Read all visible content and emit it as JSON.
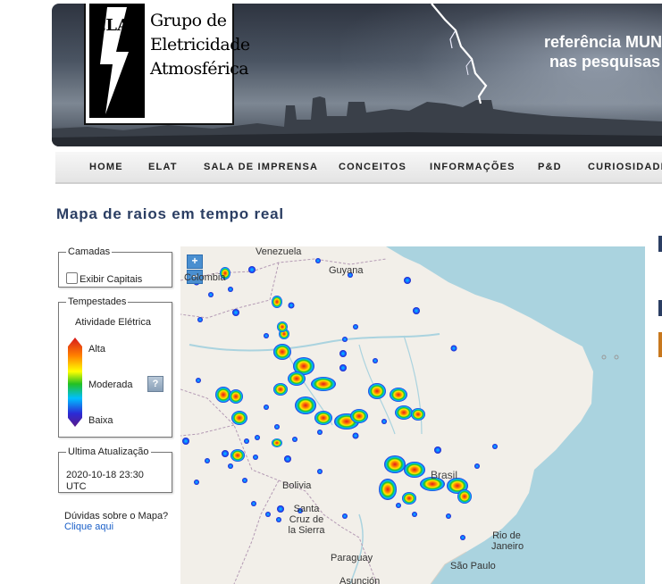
{
  "header": {
    "logo_lines": [
      "Grupo de",
      "Eletricidade",
      "Atmosférica"
    ],
    "logo_mark": "ELAT",
    "slogan": [
      "referência MUN",
      "nas pesquisas"
    ]
  },
  "nav": {
    "items": [
      "HOME",
      "ELAT",
      "SALA DE IMPRENSA",
      "CONCEITOS",
      "INFORMAÇÕES",
      "P&D",
      "CURIOSIDADE"
    ]
  },
  "page": {
    "title": "Mapa de raios em tempo real"
  },
  "sidebar": {
    "layers": {
      "legend": "Camadas",
      "checkbox_label": "Exibir Capitais",
      "checked": false
    },
    "storms": {
      "legend": "Tempestades",
      "subtitle": "Atividade Elétrica",
      "scale": [
        "Alta",
        "Moderada",
        "Baixa"
      ],
      "scale_colors": [
        "#d7191c",
        "#fdae61",
        "#ffff00",
        "#1a9641",
        "#00bfff",
        "#2b2bd6",
        "#5a1a8a"
      ],
      "help_icon": "question-icon",
      "help_symbol": "?"
    },
    "update": {
      "legend": "Ultima Atualização",
      "value": "2020-10-18 23:30 UTC"
    },
    "help": {
      "question": "Dúvidas sobre o Mapa?",
      "link": "Clique aqui"
    }
  },
  "map": {
    "zoom_in": "+",
    "zoom_out": "−",
    "labels": {
      "venezuela": "Venezuela",
      "guyana": "Guyana",
      "colombia": "Colombia",
      "bolivia": "Bolivia",
      "santa_cruz": "Santa Cruz de la Sierra",
      "brasil": "Brasil",
      "paraguay": "Paraguay",
      "rio": "Rio de Janeiro",
      "sao_paulo": "São Paulo",
      "asuncion": "Asunción"
    },
    "colors": {
      "ocean": "#aad3df",
      "land": "#f2efe9",
      "border": "#b49ab4",
      "river": "#aad3df"
    }
  }
}
